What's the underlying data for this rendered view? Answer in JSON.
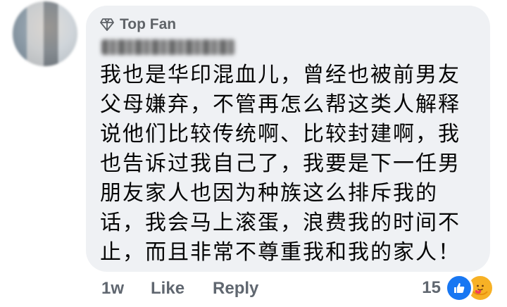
{
  "comment": {
    "badge_label": "Top Fan",
    "lines": [
      "我也是华印混血儿，曾经也被前男友",
      "父母嫌弃，不管再怎么帮这类人解释",
      "说他们比较传统啊、比较封建啊，我",
      "也告诉过我自己了，我要是下一任男",
      "朋友家人也因为种族这么排斥我的",
      "话，我会马上滚蛋，浪费我的时间不",
      "止，而且非常不尊重我和我的家人！"
    ]
  },
  "actions": {
    "time": "1w",
    "like_label": "Like",
    "reply_label": "Reply"
  },
  "reactions": {
    "count": "15",
    "types": [
      "like-icon",
      "care-icon"
    ]
  },
  "colors": {
    "bubble": "#eff1f4",
    "meta_text": "#606770",
    "like_blue": "#1877f2",
    "care_yellow": "#f7b125"
  }
}
